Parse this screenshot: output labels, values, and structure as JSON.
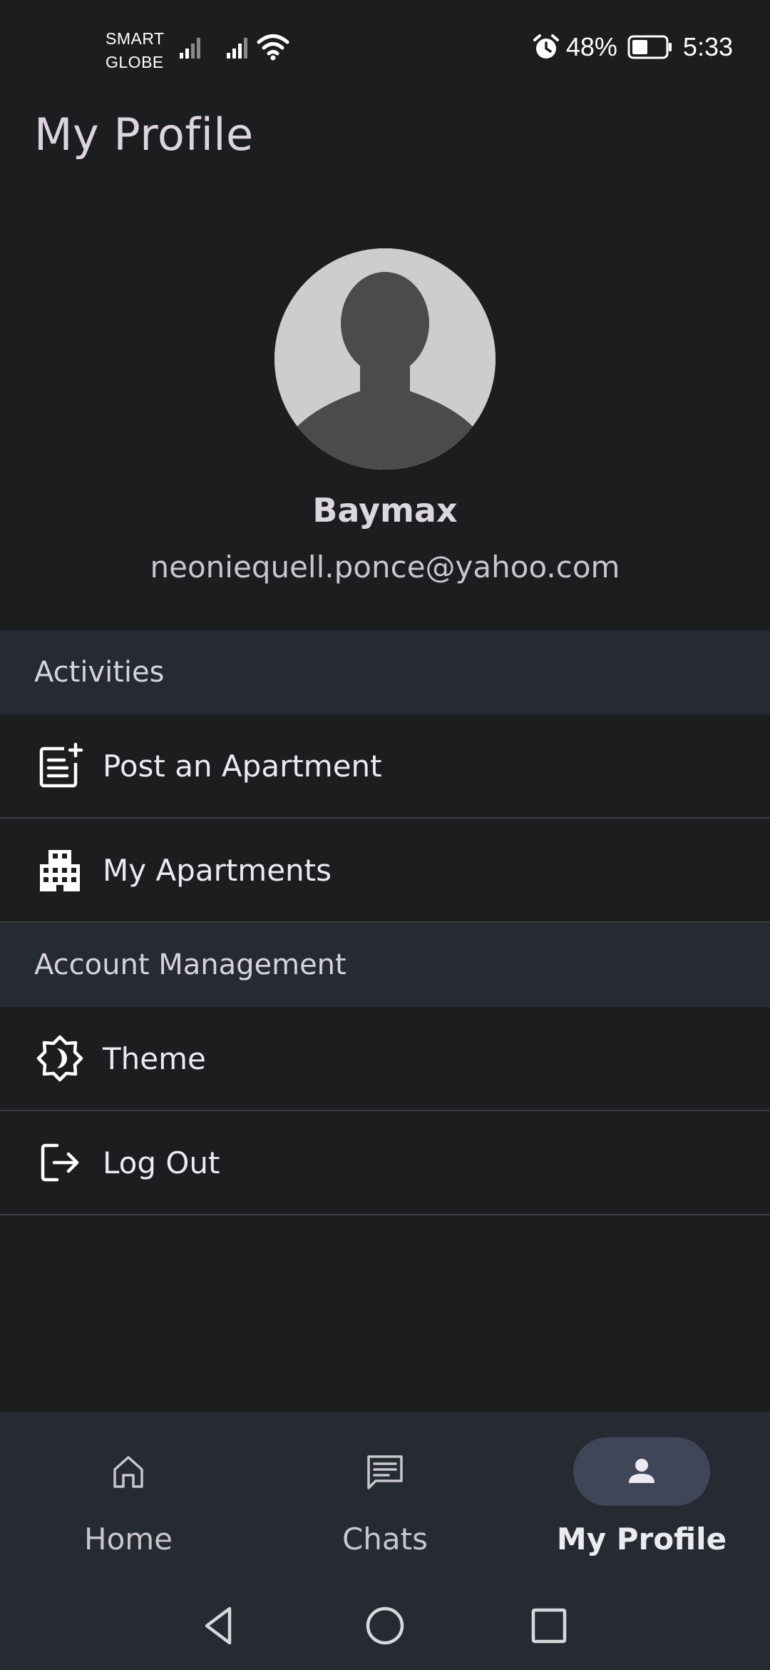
{
  "status_bar": {
    "carrier_line1": "SMART",
    "carrier_line2": "GLOBE",
    "battery_percent": "48%",
    "battery_level": 0.48,
    "time": "5:33",
    "icons": [
      "signal-icon",
      "signal-icon",
      "wifi-icon",
      "alarm-icon",
      "battery-icon"
    ]
  },
  "header": {
    "title": "My Profile"
  },
  "profile": {
    "name": "Baymax",
    "email": "neoniequell.ponce@yahoo.com",
    "avatar_icon": "default-avatar-icon"
  },
  "sections": [
    {
      "title": "Activities",
      "items": [
        {
          "label": "Post an Apartment",
          "icon": "post-add-icon"
        },
        {
          "label": "My Apartments",
          "icon": "apartment-building-icon"
        }
      ]
    },
    {
      "title": "Account Management",
      "items": [
        {
          "label": "Theme",
          "icon": "theme-brightness-icon"
        },
        {
          "label": "Log Out",
          "icon": "logout-icon"
        }
      ]
    }
  ],
  "bottom_nav": {
    "items": [
      {
        "label": "Home",
        "icon": "home-icon",
        "active": false
      },
      {
        "label": "Chats",
        "icon": "chat-icon",
        "active": false
      },
      {
        "label": "My Profile",
        "icon": "person-icon",
        "active": true
      }
    ]
  },
  "system_nav": {
    "icons": [
      "back-icon",
      "home-circle-icon",
      "recents-icon"
    ]
  },
  "colors": {
    "background": "#1c1d1f",
    "section_header": "#262a33",
    "nav_background": "#262a33",
    "active_pill": "#3e4657",
    "divider": "#3a3c40"
  }
}
